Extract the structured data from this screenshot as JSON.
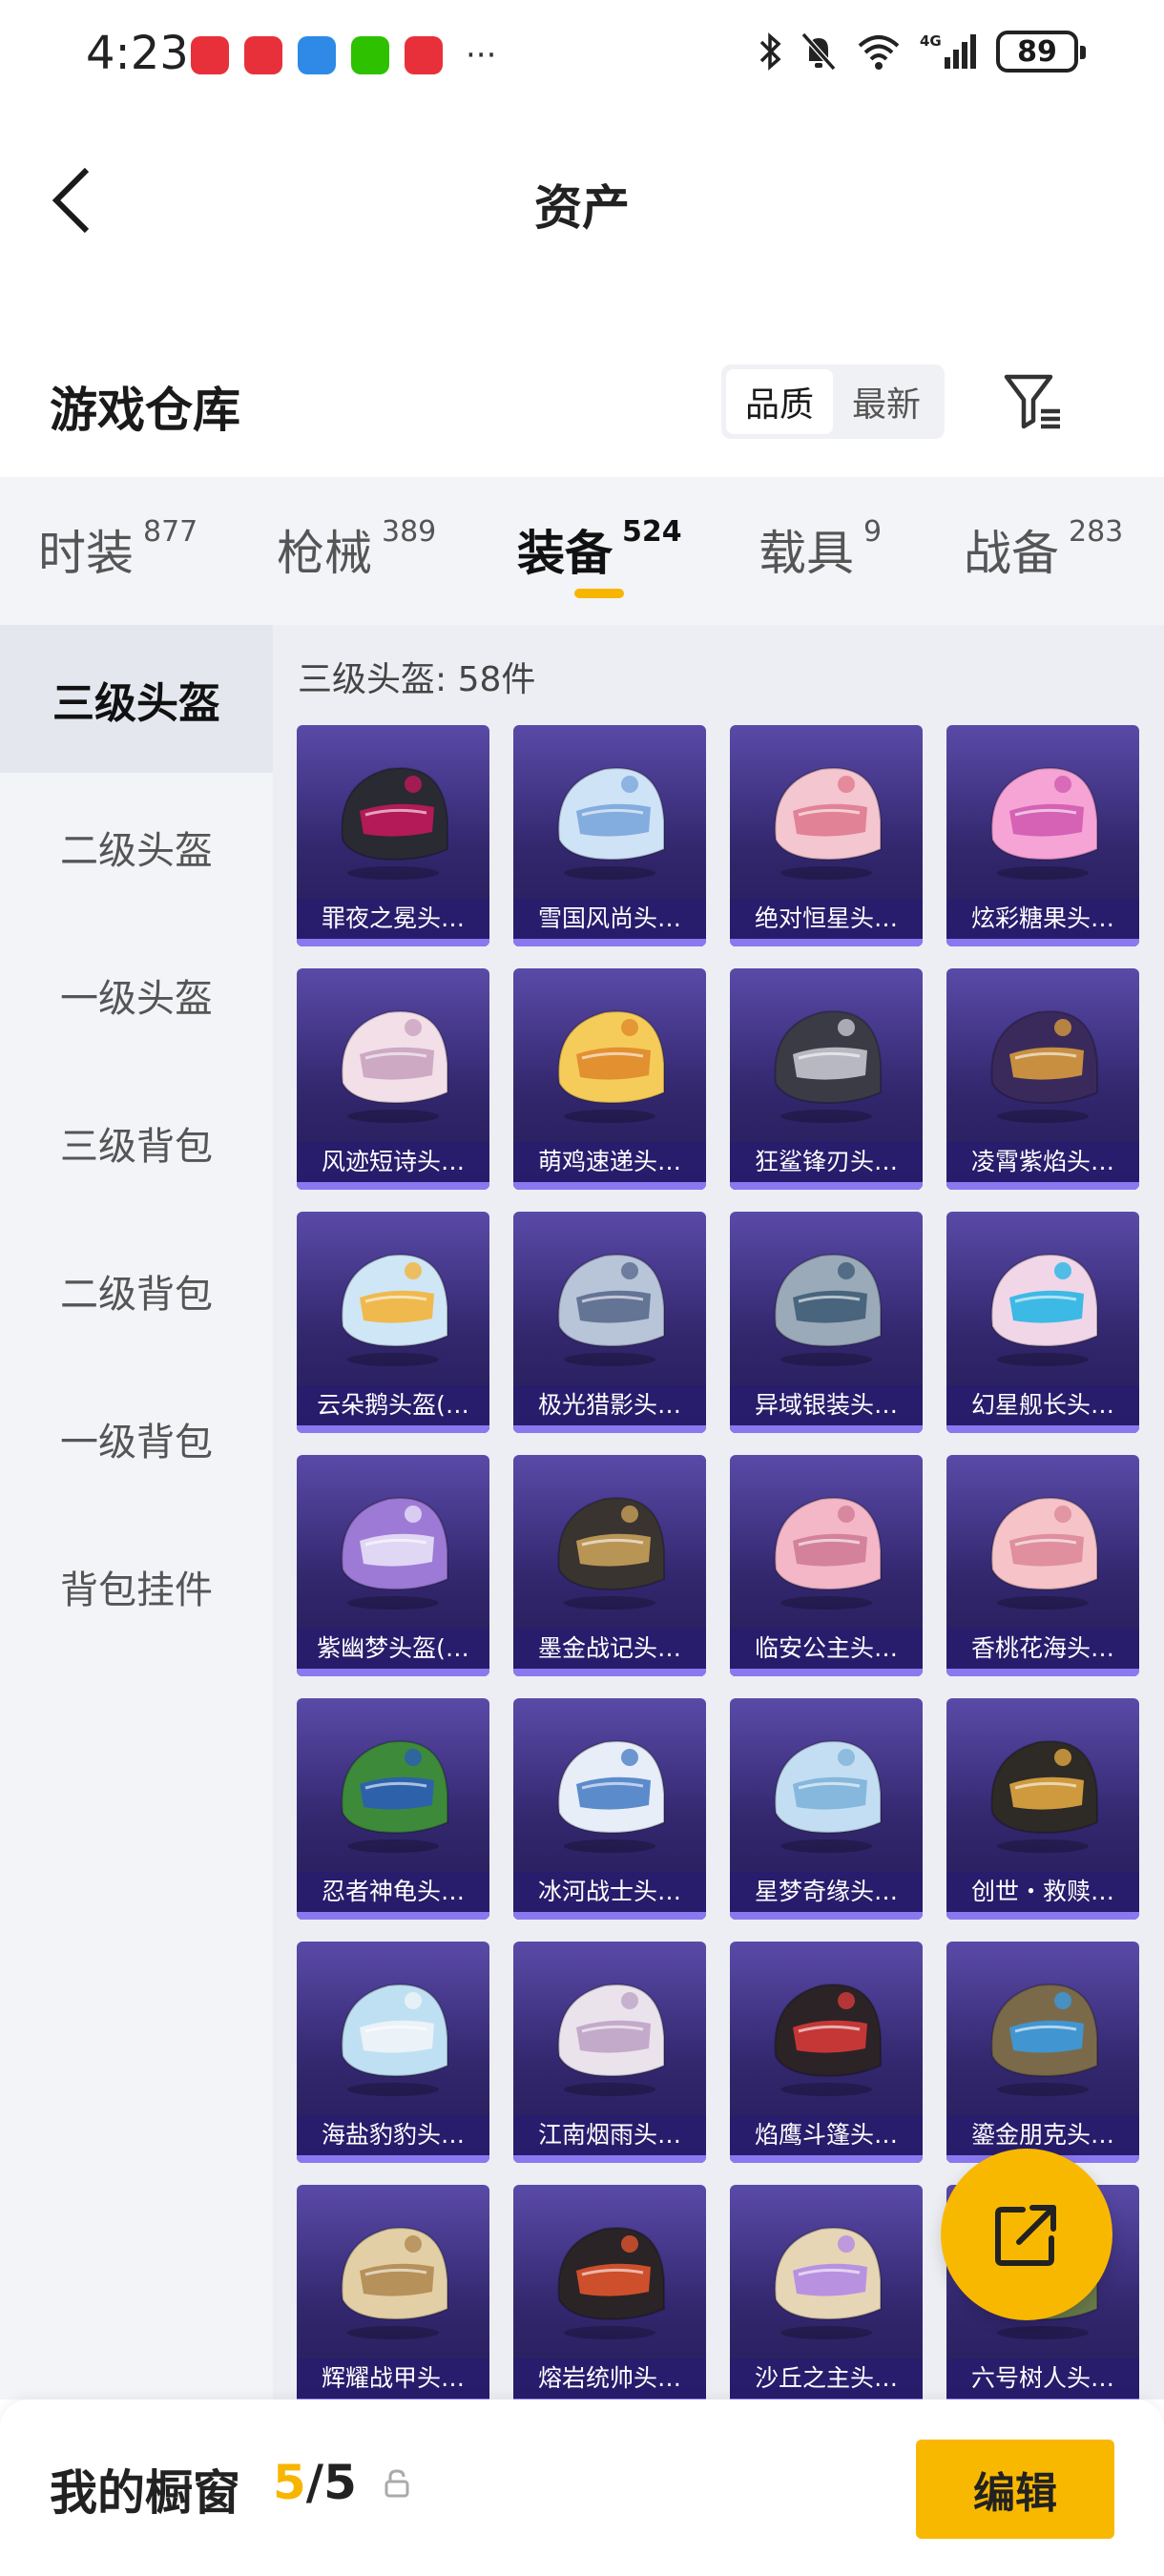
{
  "status_bar": {
    "time": "4:23",
    "network": "4G",
    "battery": "89",
    "icons": [
      "bluetooth-icon",
      "mute-icon",
      "wifi-icon",
      "signal-icon",
      "battery-icon"
    ],
    "apps": [
      {
        "name": "huawei-store-icon",
        "color": "#e8303a"
      },
      {
        "name": "redbook-icon",
        "color": "#e8303a"
      },
      {
        "name": "browser-icon",
        "color": "#2e8ae6"
      },
      {
        "name": "wechat-icon",
        "color": "#2dc100"
      },
      {
        "name": "huawei-app-icon",
        "color": "#e8303a"
      }
    ]
  },
  "header": {
    "title": "资产"
  },
  "warehouse": {
    "title": "游戏仓库",
    "sort_options": [
      {
        "label": "品质",
        "active": true
      },
      {
        "label": "最新",
        "active": false
      }
    ]
  },
  "category_tabs": [
    {
      "label": "时装",
      "count": "877",
      "active": false
    },
    {
      "label": "枪械",
      "count": "389",
      "active": false
    },
    {
      "label": "装备",
      "count": "524",
      "active": true
    },
    {
      "label": "载具",
      "count": "9",
      "active": false
    },
    {
      "label": "战备",
      "count": "283",
      "active": false
    }
  ],
  "sidebar": {
    "items": [
      {
        "label": "三级头盔",
        "active": true
      },
      {
        "label": "二级头盔",
        "active": false
      },
      {
        "label": "一级头盔",
        "active": false
      },
      {
        "label": "三级背包",
        "active": false
      },
      {
        "label": "二级背包",
        "active": false
      },
      {
        "label": "一级背包",
        "active": false
      },
      {
        "label": "背包挂件",
        "active": false
      }
    ]
  },
  "content": {
    "section_label": "三级头盔: 58件",
    "items": [
      {
        "name": "罪夜之冕头…",
        "colors": [
          "#2a2a33",
          "#c2185b"
        ]
      },
      {
        "name": "雪国风尚头…",
        "colors": [
          "#cfe3f7",
          "#7aa6dc"
        ]
      },
      {
        "name": "绝对恒星头…",
        "colors": [
          "#f4c6cf",
          "#e07a8f"
        ]
      },
      {
        "name": "炫彩糖果头…",
        "colors": [
          "#f6a3d6",
          "#d25bb0"
        ]
      },
      {
        "name": "风迹短诗头…",
        "colors": [
          "#f2dfe8",
          "#c9a3c0"
        ]
      },
      {
        "name": "萌鸡速递头…",
        "colors": [
          "#f5cc5a",
          "#e08a2b"
        ]
      },
      {
        "name": "狂鲨锋刃头…",
        "colors": [
          "#3b3b45",
          "#c7c7d0"
        ]
      },
      {
        "name": "凌霄紫焰头…",
        "colors": [
          "#3a2a5c",
          "#d79a3c"
        ]
      },
      {
        "name": "云朵鹅头盔(…",
        "colors": [
          "#cfe6f6",
          "#f3b43c"
        ]
      },
      {
        "name": "极光猎影头…",
        "colors": [
          "#b8c4d8",
          "#5b6b8e"
        ]
      },
      {
        "name": "异域银装头…",
        "colors": [
          "#9aaab8",
          "#3f5d77"
        ]
      },
      {
        "name": "幻星舰长头…",
        "colors": [
          "#f1d6e8",
          "#29b6e6"
        ]
      },
      {
        "name": "紫幽梦头盔(…",
        "colors": [
          "#9d7ad6",
          "#e8e1f7"
        ]
      },
      {
        "name": "墨金战记头…",
        "colors": [
          "#3a3430",
          "#c8a05a"
        ]
      },
      {
        "name": "临安公主头…",
        "colors": [
          "#f3b7c8",
          "#d07c96"
        ]
      },
      {
        "name": "香桃花海头…",
        "colors": [
          "#f6c3c8",
          "#dd8a98"
        ]
      },
      {
        "name": "忍者神龟头…",
        "colors": [
          "#3d8a3a",
          "#2b5db8"
        ]
      },
      {
        "name": "冰河战士头…",
        "colors": [
          "#e7eef7",
          "#4d7fc6"
        ]
      },
      {
        "name": "星梦奇缘头…",
        "colors": [
          "#c3def2",
          "#7fb3d9"
        ]
      },
      {
        "name": "创世・救赎…",
        "colors": [
          "#2e2a26",
          "#e0a640"
        ]
      },
      {
        "name": "海盐豹豹头…",
        "colors": [
          "#bfe0f2",
          "#f0f4f8"
        ]
      },
      {
        "name": "江南烟雨头…",
        "colors": [
          "#ebe3ec",
          "#bfa3c8"
        ]
      },
      {
        "name": "焰鹰斗篷头…",
        "colors": [
          "#2c2326",
          "#d63a3a"
        ]
      },
      {
        "name": "鎏金朋克头…",
        "colors": [
          "#7a6a4a",
          "#3b9ae0"
        ]
      },
      {
        "name": "辉耀战甲头…",
        "colors": [
          "#e3cfa6",
          "#b08a52"
        ]
      },
      {
        "name": "熔岩统帅头…",
        "colors": [
          "#2a2426",
          "#e0542e"
        ]
      },
      {
        "name": "沙丘之主头…",
        "colors": [
          "#e6d6b6",
          "#b48ae6"
        ]
      },
      {
        "name": "六号树人头…",
        "colors": [
          "#6a7a4a",
          "#a0844c"
        ]
      }
    ]
  },
  "bottom_bar": {
    "showcase_label": "我的橱窗",
    "count_current": "5",
    "count_sep": "/",
    "count_total": "5",
    "edit_label": "编辑",
    "accent_color": "#f9b800"
  }
}
